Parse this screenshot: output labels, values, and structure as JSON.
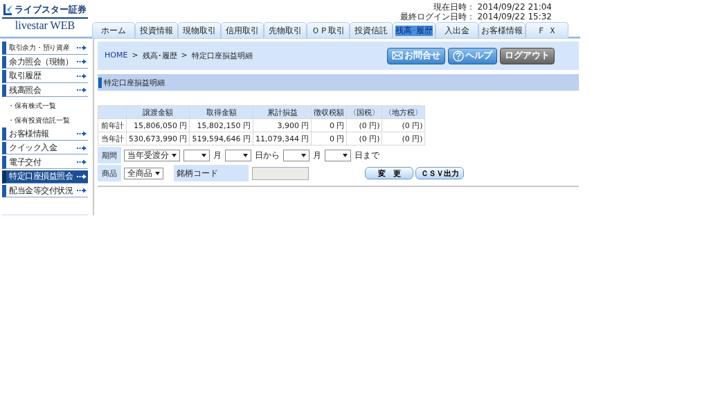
{
  "header": {
    "brand": "ライブスター証券",
    "sub_brand": "livestar WEB",
    "datetime": [
      {
        "label": "現在日時：",
        "value": "2014/09/22 21:04"
      },
      {
        "label": "最終ログイン日時：",
        "value": "2014/09/22 15:32"
      }
    ]
  },
  "tabs": [
    {
      "label": "ホーム",
      "selected": false
    },
    {
      "label": "投資情報",
      "selected": false
    },
    {
      "label": "現物取引",
      "selected": false
    },
    {
      "label": "信用取引",
      "selected": false
    },
    {
      "label": "先物取引",
      "selected": false
    },
    {
      "label": "ＯＰ取引",
      "selected": false
    },
    {
      "label": "投資信託",
      "selected": false
    },
    {
      "label": "残高･履歴",
      "selected": true
    },
    {
      "label": "入出金",
      "selected": false
    },
    {
      "label": "お客様情報",
      "selected": false
    },
    {
      "label": "Ｆ Ｘ",
      "selected": false
    }
  ],
  "sidebar": {
    "items": [
      {
        "label": "取引余力・預り資産",
        "kind": "menu",
        "selected": false,
        "small": true
      },
      {
        "label": "余力照会（現物）",
        "kind": "menu",
        "selected": false,
        "small": false
      },
      {
        "label": "取引履歴",
        "kind": "menu",
        "selected": false,
        "small": false
      },
      {
        "label": "残高照会",
        "kind": "menu",
        "selected": false,
        "small": false
      },
      {
        "label": "・保有株式一覧",
        "kind": "sub",
        "selected": false,
        "small": true
      },
      {
        "label": "・保有投資信託一覧",
        "kind": "sub",
        "selected": false,
        "small": true
      },
      {
        "label": "お客様情報",
        "kind": "menu",
        "selected": false,
        "small": false
      },
      {
        "label": "クイック入金",
        "kind": "menu",
        "selected": false,
        "small": false
      },
      {
        "label": "電子交付",
        "kind": "menu",
        "selected": false,
        "small": false
      },
      {
        "label": "特定口座損益照会",
        "kind": "menu",
        "selected": true,
        "small": false
      },
      {
        "label": "配当金等交付状況",
        "kind": "menu",
        "selected": false,
        "small": false
      }
    ]
  },
  "breadcrumb": [
    {
      "label": "HOME",
      "kind": "link"
    },
    {
      "label": ">",
      "kind": "separator"
    },
    {
      "label": "残高･履歴",
      "kind": "text"
    },
    {
      "label": ">",
      "kind": "separator"
    },
    {
      "label": "特定口座損益明細",
      "kind": "text"
    }
  ],
  "header_buttons": [
    {
      "label": "お問合せ",
      "kind": "mail"
    },
    {
      "label": "ヘルプ",
      "kind": "help"
    },
    {
      "label": "ログアウト",
      "kind": "logout"
    }
  ],
  "section_title": "特定口座損益明細",
  "summary_table": {
    "columns": [
      "譲渡金額",
      "取得金額",
      "累計損益",
      "徴収税額",
      "〈国税〉",
      "〈地方税〉"
    ],
    "rows": [
      {
        "label": "前年計",
        "cells": [
          "15,806,050 円",
          "15,802,150 円",
          "3,900 円",
          "0 円",
          "(0 円)",
          "(0 円)"
        ]
      },
      {
        "label": "当年計",
        "cells": [
          "530,673,990 円",
          "519,594,646 円",
          "11,079,344 円",
          "0 円",
          "(0 円)",
          "(0 円)"
        ]
      }
    ]
  },
  "filters": [
    {
      "label": "期間",
      "items": [
        {
          "kind": "select",
          "value": "当年受渡分"
        },
        {
          "kind": "select"
        },
        {
          "kind": "text",
          "text": "月"
        },
        {
          "kind": "select"
        },
        {
          "kind": "text",
          "text": "日から"
        },
        {
          "kind": "select"
        },
        {
          "kind": "text",
          "text": "月"
        },
        {
          "kind": "select"
        },
        {
          "kind": "text",
          "text": "日まで"
        }
      ]
    },
    {
      "label": "商品",
      "items": [
        {
          "kind": "select",
          "value": "全商品"
        },
        {
          "kind": "label",
          "text": "銘柄コード"
        },
        {
          "kind": "input"
        }
      ]
    }
  ],
  "actions": [
    "変　更",
    "ＣＳＶ出力"
  ]
}
